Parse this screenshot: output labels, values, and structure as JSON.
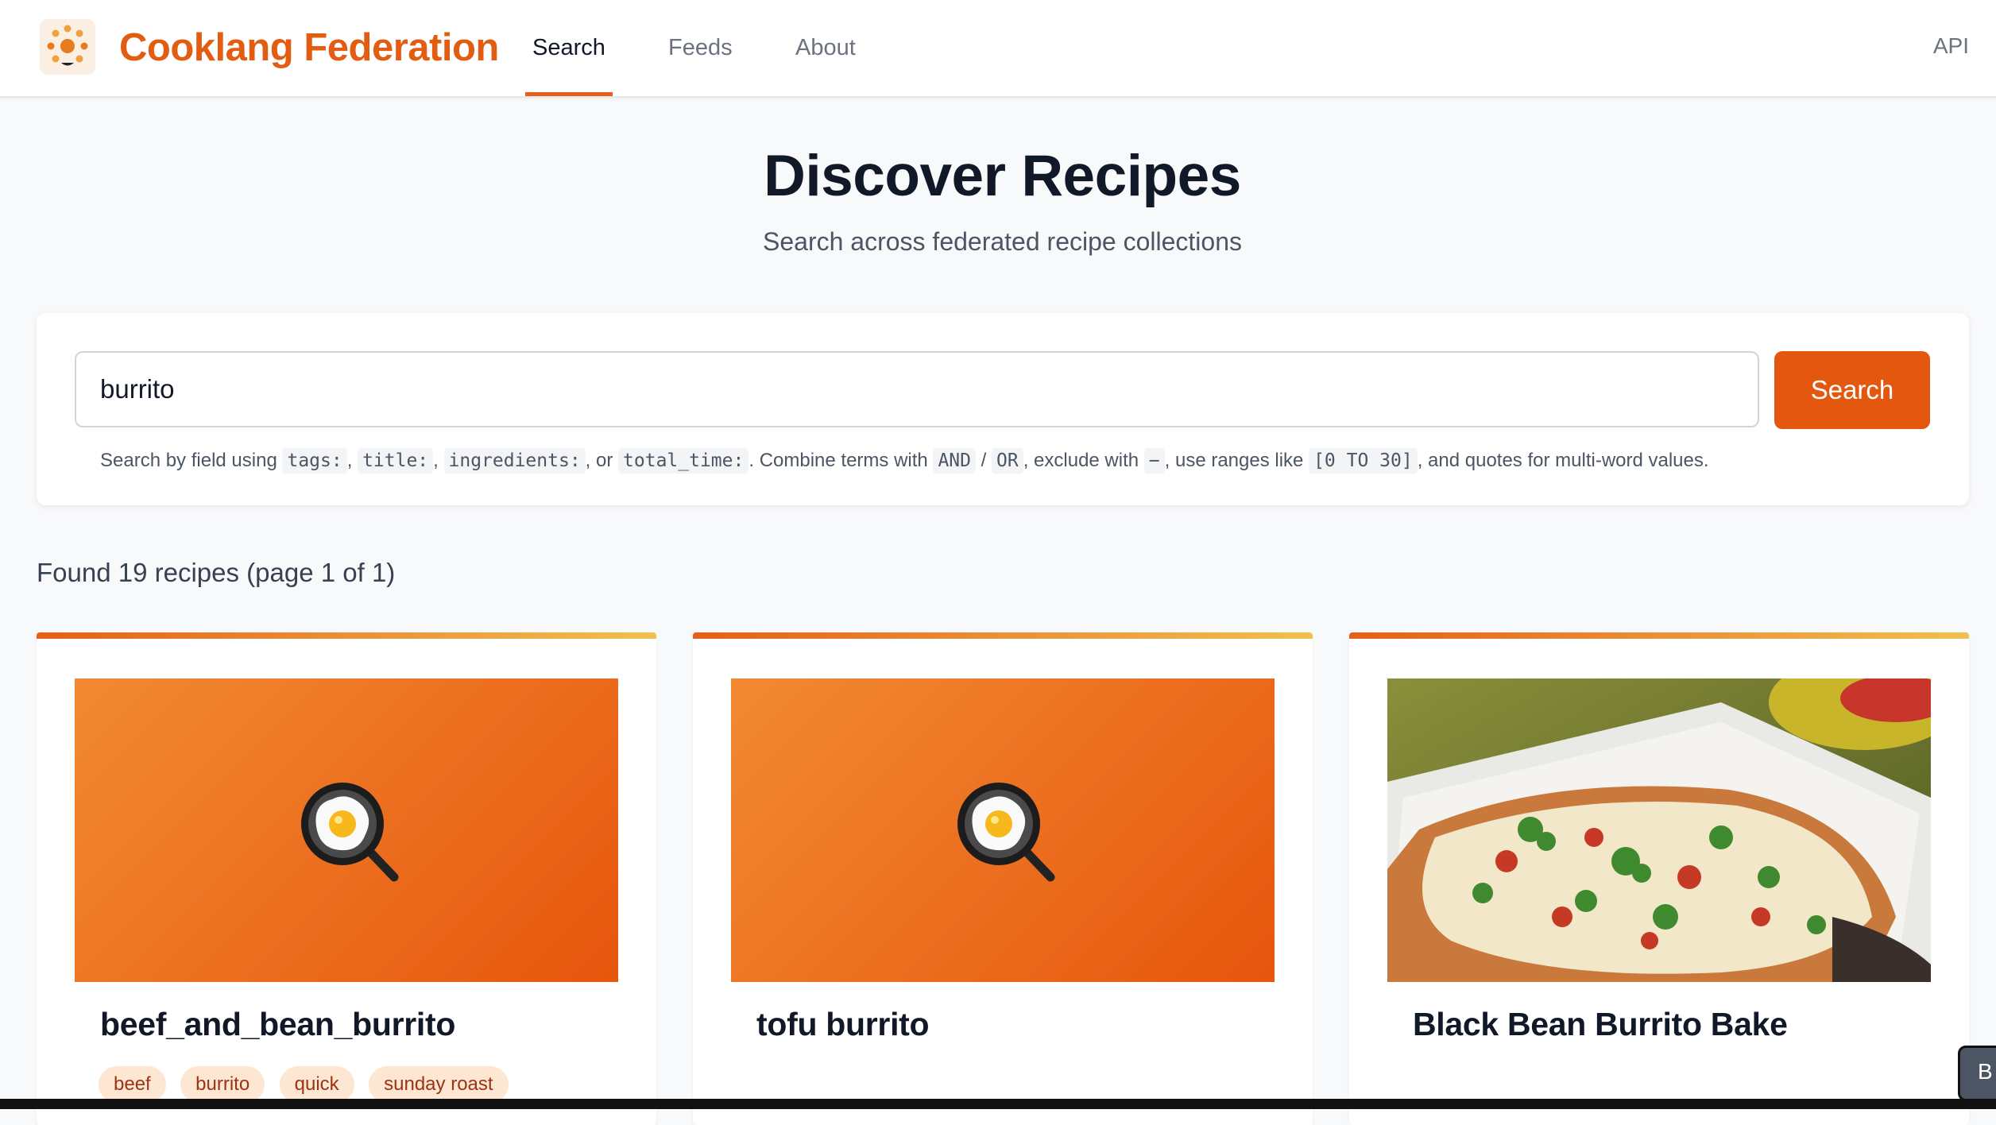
{
  "header": {
    "brand": "Cooklang Federation",
    "nav": [
      "Search",
      "Feeds",
      "About"
    ],
    "api_label": "API"
  },
  "hero": {
    "title": "Discover Recipes",
    "subtitle": "Search across federated recipe collections"
  },
  "search": {
    "value": "burrito",
    "button_label": "Search",
    "hint": {
      "t1": "Search by field using",
      "c1": "tags:",
      "t2": ",",
      "c2": "title:",
      "t3": ",",
      "c3": "ingredients:",
      "t4": ", or",
      "c4": "total_time:",
      "t5": ". Combine terms with",
      "c5": "AND",
      "t6": "/",
      "c6": "OR",
      "t7": ", exclude with",
      "c7": "−",
      "t8": ", use ranges like",
      "c8": "[0 TO 30]",
      "t9": ", and quotes for multi-word values."
    }
  },
  "results": {
    "count_text": "Found 19 recipes (page 1 of 1)"
  },
  "cards": [
    {
      "title": "beef_and_bean_burrito",
      "image": "frying-pan-placeholder",
      "tags": [
        "beef",
        "burrito",
        "quick",
        "sunday roast"
      ]
    },
    {
      "title": "tofu burrito",
      "image": "frying-pan-placeholder",
      "tags": []
    },
    {
      "title": "Black Bean Burrito Bake",
      "image": "burrito-bake-photo",
      "tags": []
    }
  ],
  "corner_widget": {
    "label": "B"
  },
  "colors": {
    "brand": "#e25d12",
    "accent": "#e4570f",
    "tag_bg": "#fde6d2",
    "tag_text": "#9a3412"
  }
}
